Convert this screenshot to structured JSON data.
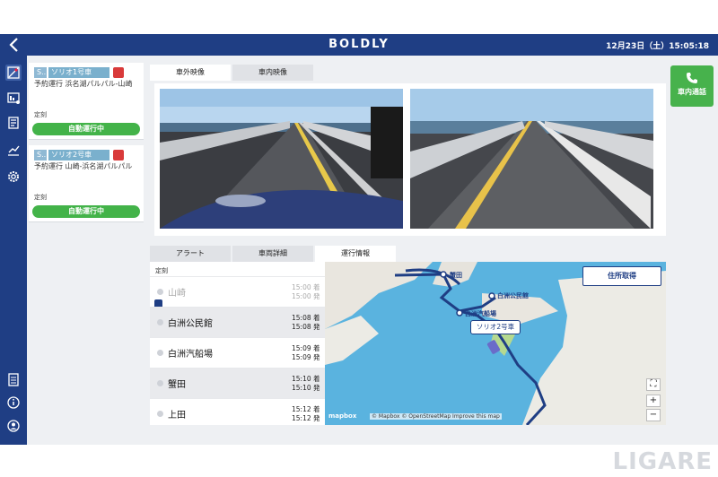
{
  "header": {
    "title": "BOLDLY",
    "datetime": "12月23日（土）15:05:18",
    "back_icon": "back-arrow-icon"
  },
  "colors": {
    "nav": "#1f3e84",
    "active_green": "#43b349",
    "alert_red": "#d93a3a"
  },
  "vehicles": [
    {
      "tag": "S...",
      "name": "ソリオ1号車",
      "route": "予約運行 浜名湖パルパル-山崎",
      "schedule_label": "定刻",
      "status": "自動運行中"
    },
    {
      "tag": "S...",
      "name": "ソリオ2号車",
      "route": "予約運行 山崎-浜名湖パルパル",
      "schedule_label": "定刻",
      "status": "自動運行中"
    }
  ],
  "camera": {
    "tabs": [
      "車外映像",
      "車内映像"
    ],
    "active_tab": 0
  },
  "call_button": {
    "label": "車内通話"
  },
  "info": {
    "tabs": [
      "アラート",
      "車両詳細",
      "運行情報"
    ],
    "active_tab": 2,
    "schedule_header": "定刻",
    "stops": [
      {
        "name": "山崎",
        "arr": "15:00 着",
        "dep": "15:00 発",
        "past": true
      },
      {
        "name": "白洲公民館",
        "arr": "15:08 着",
        "dep": "15:08 発",
        "past": false
      },
      {
        "name": "白洲汽船場",
        "arr": "15:09 着",
        "dep": "15:09 発",
        "past": false
      },
      {
        "name": "蟹田",
        "arr": "15:10 着",
        "dep": "15:10 発",
        "past": false
      },
      {
        "name": "上田",
        "arr": "15:12 着",
        "dep": "15:12 発",
        "past": false
      }
    ]
  },
  "map": {
    "address_button": "住所取得",
    "vehicle_label": "ソリオ2号車",
    "labels": [
      "蟹田",
      "白洲公民館",
      "白洲汽船場"
    ],
    "zoom_in": "+",
    "zoom_out": "−",
    "brand": "mapbox",
    "attribution": "© Mapbox © OpenStreetMap  Improve this map"
  },
  "watermark": "LIGARE"
}
